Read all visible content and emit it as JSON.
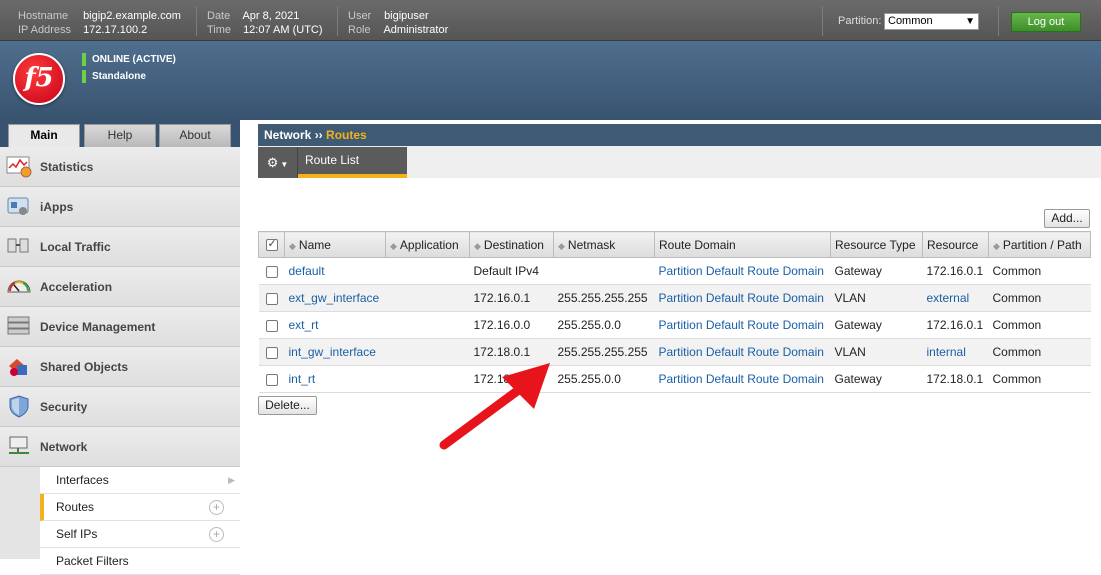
{
  "header": {
    "hostname_label": "Hostname",
    "hostname": "bigip2.example.com",
    "ip_label": "IP Address",
    "ip": "172.17.100.2",
    "date_label": "Date",
    "date": "Apr 8, 2021",
    "time_label": "Time",
    "time": "12:07 AM (UTC)",
    "user_label": "User",
    "user": "bigipuser",
    "role_label": "Role",
    "role": "Administrator",
    "partition_label": "Partition:",
    "partition_value": "Common",
    "logout_label": "Log out"
  },
  "banner": {
    "logo_text": "f5",
    "status_1": "ONLINE (ACTIVE)",
    "status_2": "Standalone"
  },
  "nav_tabs": [
    "Main",
    "Help",
    "About"
  ],
  "sidebar": {
    "items": [
      {
        "label": "Statistics",
        "icon": "statistics-icon"
      },
      {
        "label": "iApps",
        "icon": "iapps-icon"
      },
      {
        "label": "Local Traffic",
        "icon": "local-traffic-icon"
      },
      {
        "label": "Acceleration",
        "icon": "acceleration-icon"
      },
      {
        "label": "Device Management",
        "icon": "device-management-icon"
      },
      {
        "label": "Shared Objects",
        "icon": "shared-objects-icon"
      },
      {
        "label": "Security",
        "icon": "security-icon"
      },
      {
        "label": "Network",
        "icon": "network-icon"
      }
    ],
    "subitems": [
      {
        "label": "Interfaces"
      },
      {
        "label": "Routes"
      },
      {
        "label": "Self IPs"
      },
      {
        "label": "Packet Filters"
      }
    ]
  },
  "main": {
    "breadcrumb_section": "Network",
    "breadcrumb_sep": "››",
    "breadcrumb_current": "Routes",
    "tab_label": "Route List",
    "add_label": "Add...",
    "delete_label": "Delete...",
    "columns": [
      "Name",
      "Application",
      "Destination",
      "Netmask",
      "Route Domain",
      "Resource Type",
      "Resource",
      "Partition / Path"
    ],
    "rows": [
      {
        "name": "default",
        "application": "",
        "destination": "Default IPv4",
        "netmask": "",
        "route_domain": "Partition Default Route Domain",
        "resource_type": "Gateway",
        "resource": "172.16.0.1",
        "partition": "Common"
      },
      {
        "name": "ext_gw_interface",
        "application": "",
        "destination": "172.16.0.1",
        "netmask": "255.255.255.255",
        "route_domain": "Partition Default Route Domain",
        "resource_type": "VLAN",
        "resource": "external",
        "partition": "Common"
      },
      {
        "name": "ext_rt",
        "application": "",
        "destination": "172.16.0.0",
        "netmask": "255.255.0.0",
        "route_domain": "Partition Default Route Domain",
        "resource_type": "Gateway",
        "resource": "172.16.0.1",
        "partition": "Common"
      },
      {
        "name": "int_gw_interface",
        "application": "",
        "destination": "172.18.0.1",
        "netmask": "255.255.255.255",
        "route_domain": "Partition Default Route Domain",
        "resource_type": "VLAN",
        "resource": "internal",
        "partition": "Common"
      },
      {
        "name": "int_rt",
        "application": "",
        "destination": "172.18.0.0",
        "netmask": "255.255.0.0",
        "route_domain": "Partition Default Route Domain",
        "resource_type": "Gateway",
        "resource": "172.18.0.1",
        "partition": "Common"
      }
    ]
  },
  "colors": {
    "accent": "#f4b21a",
    "link": "#1a5fa6",
    "logout": "#4fa43a",
    "annotation_arrow": "#e8141c"
  }
}
